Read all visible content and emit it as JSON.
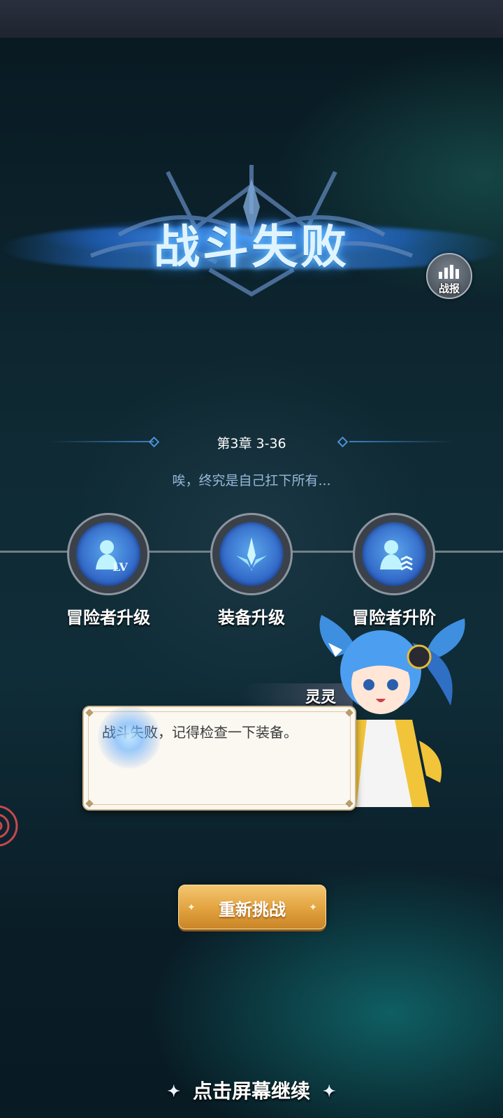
{
  "result": {
    "title": "战斗失败",
    "report_label": "战报",
    "chapter": "第3章 3-36",
    "subtitle": "唉，终究是自己扛下所有..."
  },
  "options": [
    {
      "label": "冒险者升级",
      "icon": "adventurer-levelup-icon",
      "badge": "LV"
    },
    {
      "label": "装备升级",
      "icon": "equipment-upgrade-icon"
    },
    {
      "label": "冒险者升阶",
      "icon": "adventurer-rankup-icon"
    }
  ],
  "dialog": {
    "speaker": "灵灵",
    "text": "战斗失败，记得检查一下装备。"
  },
  "retry_label": "重新挑战",
  "continue_text": "点击屏幕继续",
  "colors": {
    "title_glow": "#6fc3ff",
    "retry_gold": "#e2a23f",
    "option_blue": "#2d62c4",
    "dialog_bg": "#fbf8f2"
  }
}
